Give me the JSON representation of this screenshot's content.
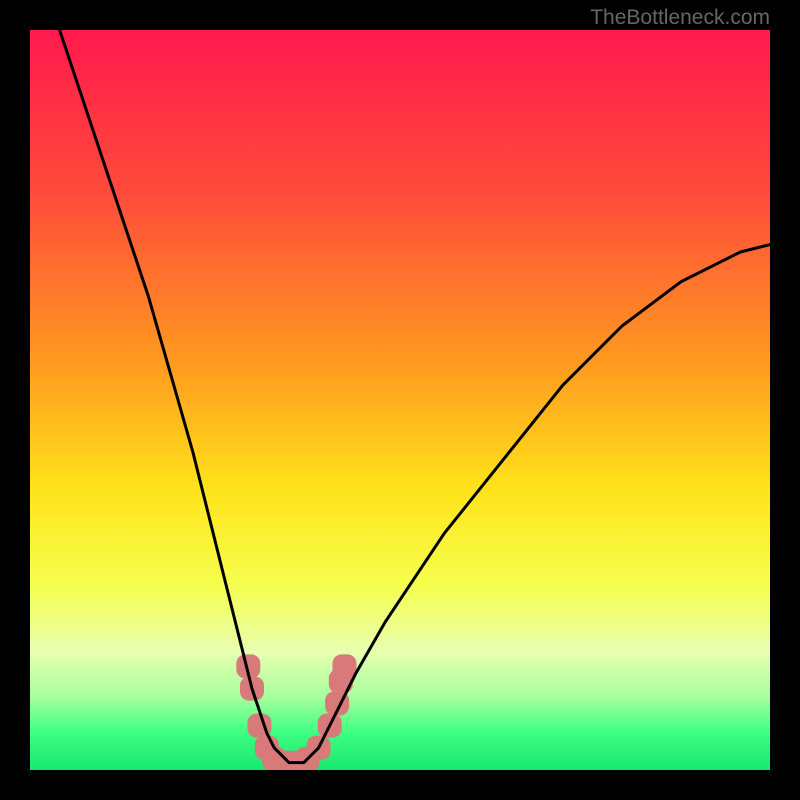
{
  "watermark": "TheBottleneck.com",
  "chart_data": {
    "type": "line",
    "title": "",
    "xlabel": "",
    "ylabel": "",
    "ylim": [
      0,
      100
    ],
    "xlim": [
      0,
      100
    ],
    "background_gradient_stops": [
      {
        "offset": 0,
        "color": "#ff1a4d"
      },
      {
        "offset": 22,
        "color": "#ff4b3a"
      },
      {
        "offset": 45,
        "color": "#ff9a1f"
      },
      {
        "offset": 62,
        "color": "#ffe31a"
      },
      {
        "offset": 75,
        "color": "#f5ff4d"
      },
      {
        "offset": 84,
        "color": "#e8ffb0"
      },
      {
        "offset": 90,
        "color": "#a8ff9e"
      },
      {
        "offset": 95,
        "color": "#3dff82"
      },
      {
        "offset": 100,
        "color": "#18e86f"
      }
    ],
    "series": [
      {
        "name": "curve",
        "color": "#000000",
        "x": [
          4,
          6,
          8,
          10,
          12,
          14,
          16,
          18,
          20,
          22,
          24,
          26,
          28,
          29,
          30,
          31,
          32,
          33,
          34,
          35,
          36,
          37,
          38,
          39,
          40,
          42,
          44,
          48,
          52,
          56,
          60,
          64,
          68,
          72,
          76,
          80,
          84,
          88,
          92,
          96,
          100
        ],
        "y": [
          100,
          94,
          88,
          82,
          76,
          70,
          64,
          57,
          50,
          43,
          35,
          27,
          19,
          15,
          11,
          8,
          5,
          3,
          2,
          1,
          1,
          1,
          2,
          3,
          5,
          9,
          13,
          20,
          26,
          32,
          37,
          42,
          47,
          52,
          56,
          60,
          63,
          66,
          68,
          70,
          71
        ]
      }
    ],
    "markers": {
      "name": "bottleneck-markers",
      "color": "#d97a7a",
      "points": [
        {
          "x": 29.5,
          "y": 14
        },
        {
          "x": 30,
          "y": 11
        },
        {
          "x": 31,
          "y": 6
        },
        {
          "x": 32,
          "y": 3
        },
        {
          "x": 33,
          "y": 1.5
        },
        {
          "x": 34.5,
          "y": 1
        },
        {
          "x": 36,
          "y": 1
        },
        {
          "x": 37.5,
          "y": 1.5
        },
        {
          "x": 39,
          "y": 3
        },
        {
          "x": 40.5,
          "y": 6
        },
        {
          "x": 41.5,
          "y": 9
        },
        {
          "x": 42,
          "y": 12
        },
        {
          "x": 42.5,
          "y": 14
        }
      ]
    }
  }
}
